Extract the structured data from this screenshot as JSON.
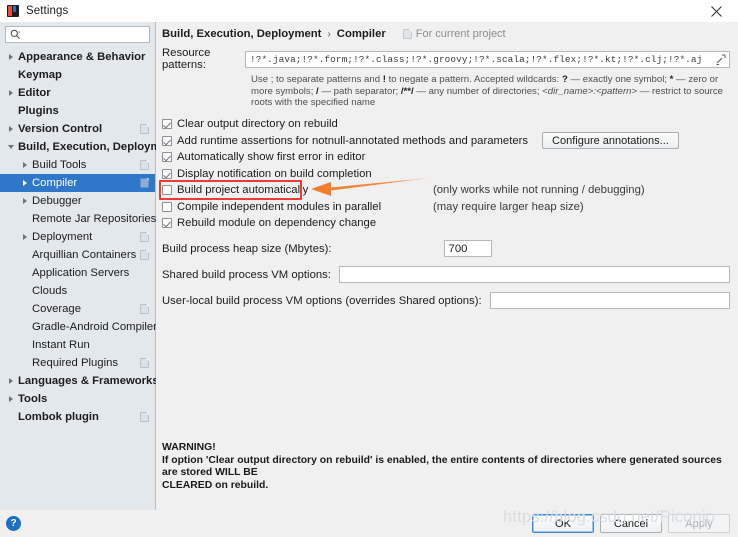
{
  "window": {
    "title": "Settings",
    "app_icon": "intellij-icon",
    "close_icon": "close-icon"
  },
  "sidebar": {
    "search": {
      "placeholder": "",
      "value": "",
      "icon": "search-icon"
    },
    "items": [
      {
        "label": "Appearance & Behavior",
        "indent": 0,
        "twisty": "collapsed",
        "bold": true,
        "badge": false,
        "selected": false
      },
      {
        "label": "Keymap",
        "indent": 0,
        "twisty": "none",
        "bold": true,
        "badge": false,
        "selected": false
      },
      {
        "label": "Editor",
        "indent": 0,
        "twisty": "collapsed",
        "bold": true,
        "badge": false,
        "selected": false
      },
      {
        "label": "Plugins",
        "indent": 0,
        "twisty": "none",
        "bold": true,
        "badge": false,
        "selected": false
      },
      {
        "label": "Version Control",
        "indent": 0,
        "twisty": "collapsed",
        "bold": true,
        "badge": true,
        "selected": false
      },
      {
        "label": "Build, Execution, Deployment",
        "indent": 0,
        "twisty": "expanded",
        "bold": true,
        "badge": false,
        "selected": false
      },
      {
        "label": "Build Tools",
        "indent": 1,
        "twisty": "collapsed",
        "bold": false,
        "badge": true,
        "selected": false
      },
      {
        "label": "Compiler",
        "indent": 1,
        "twisty": "collapsed",
        "bold": false,
        "badge": true,
        "selected": true
      },
      {
        "label": "Debugger",
        "indent": 1,
        "twisty": "collapsed",
        "bold": false,
        "badge": false,
        "selected": false
      },
      {
        "label": "Remote Jar Repositories",
        "indent": 1,
        "twisty": "none",
        "bold": false,
        "badge": true,
        "selected": false
      },
      {
        "label": "Deployment",
        "indent": 1,
        "twisty": "collapsed",
        "bold": false,
        "badge": true,
        "selected": false
      },
      {
        "label": "Arquillian Containers",
        "indent": 1,
        "twisty": "none",
        "bold": false,
        "badge": true,
        "selected": false
      },
      {
        "label": "Application Servers",
        "indent": 1,
        "twisty": "none",
        "bold": false,
        "badge": false,
        "selected": false
      },
      {
        "label": "Clouds",
        "indent": 1,
        "twisty": "none",
        "bold": false,
        "badge": false,
        "selected": false
      },
      {
        "label": "Coverage",
        "indent": 1,
        "twisty": "none",
        "bold": false,
        "badge": true,
        "selected": false
      },
      {
        "label": "Gradle-Android Compiler",
        "indent": 1,
        "twisty": "none",
        "bold": false,
        "badge": true,
        "selected": false
      },
      {
        "label": "Instant Run",
        "indent": 1,
        "twisty": "none",
        "bold": false,
        "badge": false,
        "selected": false
      },
      {
        "label": "Required Plugins",
        "indent": 1,
        "twisty": "none",
        "bold": false,
        "badge": true,
        "selected": false
      },
      {
        "label": "Languages & Frameworks",
        "indent": 0,
        "twisty": "collapsed",
        "bold": true,
        "badge": false,
        "selected": false
      },
      {
        "label": "Tools",
        "indent": 0,
        "twisty": "collapsed",
        "bold": true,
        "badge": false,
        "selected": false
      },
      {
        "label": "Lombok plugin",
        "indent": 0,
        "twisty": "none",
        "bold": true,
        "badge": true,
        "selected": false
      }
    ]
  },
  "content": {
    "breadcrumb": {
      "parent": "Build, Execution, Deployment",
      "separator": "›",
      "current": "Compiler",
      "project_scope": "For current project"
    },
    "resource_patterns": {
      "label": "Resource patterns:",
      "value": "!?*.java;!?*.form;!?*.class;!?*.groovy;!?*.scala;!?*.flex;!?*.kt;!?*.clj;!?*.aj",
      "expand_icon": "expand-icon",
      "hint_line1_a": "Use ; to separate patterns and ",
      "hint_line1_b": "!",
      "hint_line1_c": " to negate a pattern. Accepted wildcards: ",
      "hint_line1_d": "?",
      "hint_line1_e": " — exactly one symbol; ",
      "hint_line1_f": "*",
      "hint_line1_g": " — zero or more symbols;",
      "hint_line2_a": "/",
      "hint_line2_b": " — path separator; ",
      "hint_line2_c": "/**/",
      "hint_line2_d": " — any number of directories; ",
      "hint_line2_e": "<dir_name>:<pattern>",
      "hint_line2_f": " — restrict to source roots with the specified",
      "hint_line3": "name"
    },
    "checkboxes": [
      {
        "label": "Clear output directory on rebuild",
        "checked": true,
        "note": "",
        "button": ""
      },
      {
        "label": "Add runtime assertions for notnull-annotated methods and parameters",
        "checked": true,
        "note": "",
        "button": "Configure annotations..."
      },
      {
        "label": "Automatically show first error in editor",
        "checked": true,
        "note": "",
        "button": ""
      },
      {
        "label": "Display notification on build completion",
        "checked": true,
        "note": "",
        "button": ""
      },
      {
        "label": "Build project automatically",
        "checked": false,
        "note": "(only works while not running / debugging)",
        "button": ""
      },
      {
        "label": "Compile independent modules in parallel",
        "checked": false,
        "note": "(may require larger heap size)",
        "button": ""
      },
      {
        "label": "Rebuild module on dependency change",
        "checked": true,
        "note": "",
        "button": ""
      }
    ],
    "fields": [
      {
        "label": "Build process heap size (Mbytes):",
        "value": "700",
        "wide": false
      },
      {
        "label": "Shared build process VM options:",
        "value": "",
        "wide": true
      },
      {
        "label": "User-local build process VM options (overrides Shared options):",
        "value": "",
        "wide": true
      }
    ],
    "warning": {
      "heading": "WARNING!",
      "line1": "If option 'Clear output directory on rebuild' is enabled, the entire contents of directories where generated sources are stored WILL BE",
      "line2": "CLEARED on rebuild."
    }
  },
  "annotations": {
    "highlight_target": "Build project automatically",
    "highlight_color": "#ee3a35",
    "arrow_color": "#f08030",
    "arrow_direction": "left"
  },
  "footer": {
    "help_label": "?",
    "ok_label": "OK",
    "cancel_label": "Cancel",
    "apply_label": "Apply"
  },
  "watermark": "https://blog.csdn.net/Piconjo"
}
